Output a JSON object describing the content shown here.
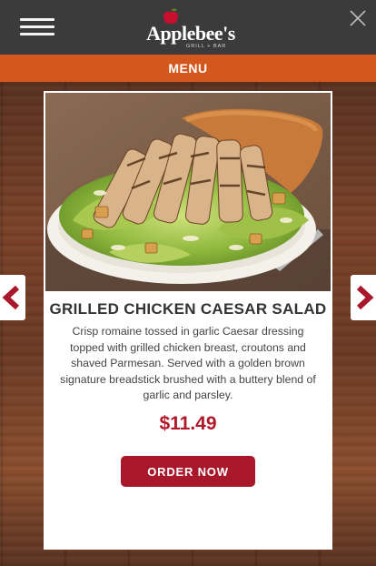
{
  "header": {
    "brand_name": "Applebee's",
    "brand_sub": "GRILL + BAR",
    "menu_icon": "hamburger-icon",
    "close_icon": "close-icon"
  },
  "menubar": {
    "label": "MENU"
  },
  "item": {
    "title": "GRILLED CHICKEN CAESAR SALAD",
    "description": "Crisp romaine tossed in garlic Caesar dressing topped with grilled chicken breast, croutons and shaved Parmesan. Served with a golden brown signature breadstick brushed with a buttery blend of garlic and parsley.",
    "price": "$11.49",
    "order_label": "ORDER NOW"
  },
  "nav": {
    "prev_icon": "chevron-left-icon",
    "next_icon": "chevron-right-icon"
  },
  "colors": {
    "header_bg": "#3b3b3b",
    "menubar_bg": "#d4581d",
    "accent_red": "#a8182a"
  }
}
